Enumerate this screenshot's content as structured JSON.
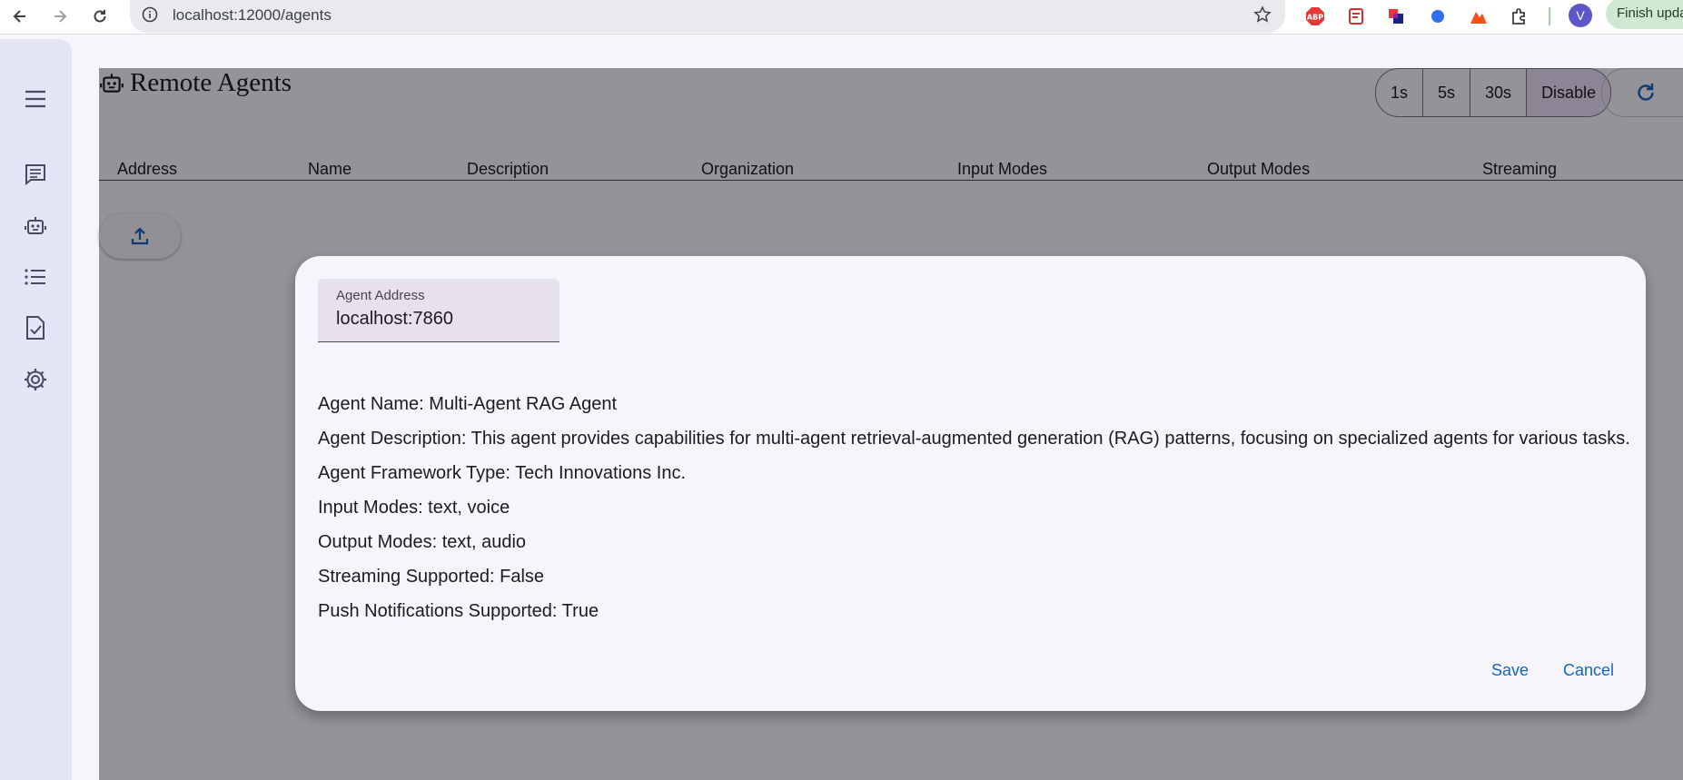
{
  "browser": {
    "url": "localhost:12000/agents",
    "profile_initial": "V",
    "finish_update_label": "Finish update",
    "extensions": [
      "adblock-icon",
      "pdf-extension-icon",
      "color-extension-icon",
      "blue-dot-extension-icon",
      "orange-extension-icon",
      "puzzle-icon"
    ]
  },
  "sidebar": {
    "items": [
      {
        "icon": "menu-icon"
      },
      {
        "icon": "chat-icon"
      },
      {
        "icon": "robot-icon"
      },
      {
        "icon": "list-icon"
      },
      {
        "icon": "task-icon"
      },
      {
        "icon": "settings-icon"
      }
    ]
  },
  "page": {
    "title": "Remote Agents",
    "refresh_options": [
      "1s",
      "5s",
      "30s",
      "Disable"
    ],
    "refresh_selected": "Disable",
    "columns": [
      "Address",
      "Name",
      "Description",
      "Organization",
      "Input Modes",
      "Output Modes",
      "Streaming"
    ]
  },
  "dialog": {
    "field_label": "Agent Address",
    "field_value": "localhost:7860",
    "lines": [
      "Agent Name: Multi-Agent RAG Agent",
      "Agent Description: This agent provides capabilities for multi-agent retrieval-augmented generation (RAG) patterns, focusing on specialized agents for various tasks.",
      "Agent Framework Type: Tech Innovations Inc.",
      "Input Modes: text, voice",
      "Output Modes: text, audio",
      "Streaming Supported: False",
      "Push Notifications Supported: True"
    ],
    "save_label": "Save",
    "cancel_label": "Cancel"
  },
  "colors": {
    "accent": "#1565c0",
    "sidebar": "#e4e6f5",
    "selected_segment": "#e8def8"
  }
}
